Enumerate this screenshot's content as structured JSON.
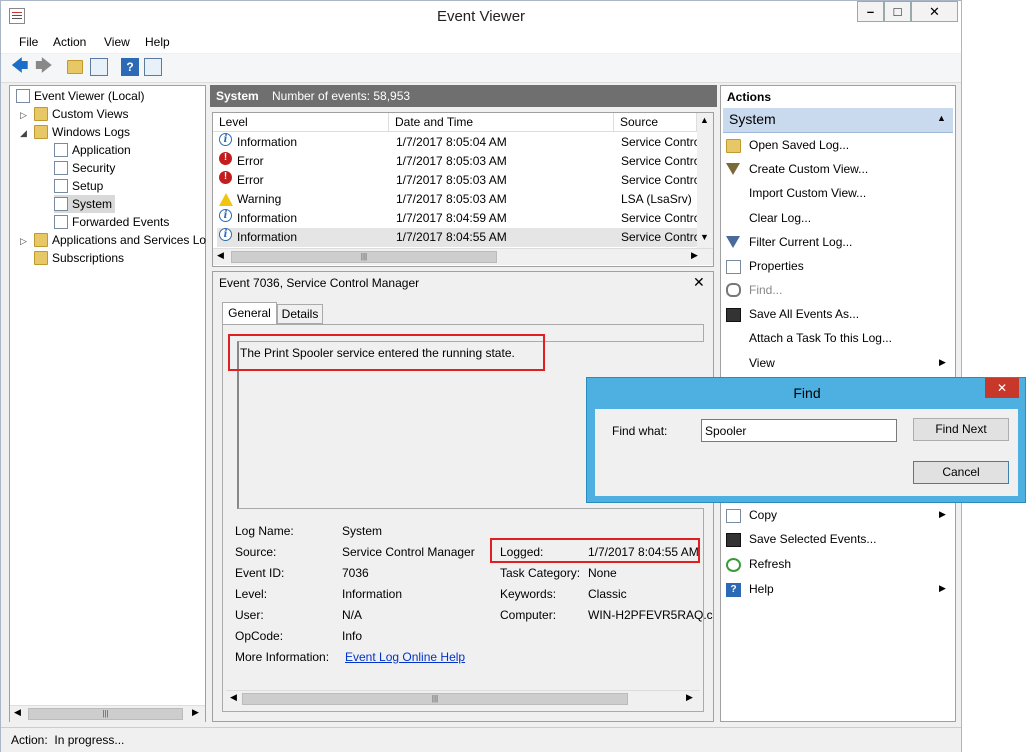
{
  "window": {
    "title": "Event Viewer"
  },
  "menu": [
    "File",
    "Action",
    "View",
    "Help"
  ],
  "tree": {
    "root": "Event Viewer (Local)",
    "custom_views": "Custom Views",
    "windows_logs": "Windows Logs",
    "application": "Application",
    "security": "Security",
    "setup": "Setup",
    "system": "System",
    "forwarded": "Forwarded Events",
    "apps_services": "Applications and Services Lo",
    "subscriptions": "Subscriptions"
  },
  "log_header": {
    "name": "System",
    "count": "Number of events: 58,953"
  },
  "columns": [
    "Level",
    "Date and Time",
    "Source"
  ],
  "events": [
    {
      "level": "Information",
      "icon": "info",
      "time": "1/7/2017 8:05:04 AM",
      "source": "Service Contro"
    },
    {
      "level": "Error",
      "icon": "error",
      "time": "1/7/2017 8:05:03 AM",
      "source": "Service Contro"
    },
    {
      "level": "Error",
      "icon": "error",
      "time": "1/7/2017 8:05:03 AM",
      "source": "Service Contro"
    },
    {
      "level": "Warning",
      "icon": "warning",
      "time": "1/7/2017 8:05:03 AM",
      "source": "LSA (LsaSrv)"
    },
    {
      "level": "Information",
      "icon": "info",
      "time": "1/7/2017 8:04:59 AM",
      "source": "Service Contro"
    },
    {
      "level": "Information",
      "icon": "info",
      "time": "1/7/2017 8:04:55 AM",
      "source": "Service Contro"
    }
  ],
  "detail": {
    "title": "Event 7036, Service Control Manager",
    "tabs": [
      "General",
      "Details"
    ],
    "message": "The Print Spooler service entered the running state.",
    "log_name_label": "Log Name:",
    "log_name": "System",
    "source_label": "Source:",
    "source": "Service Control Manager",
    "logged_label": "Logged:",
    "logged": "1/7/2017 8:04:55 AM",
    "event_id_label": "Event ID:",
    "event_id": "7036",
    "task_label": "Task Category:",
    "task": "None",
    "level_label": "Level:",
    "level": "Information",
    "keywords_label": "Keywords:",
    "keywords": "Classic",
    "user_label": "User:",
    "user": "N/A",
    "computer_label": "Computer:",
    "computer": "WIN-H2PFEVR5RAQ.c",
    "opcode_label": "OpCode:",
    "opcode": "Info",
    "more_label": "More Information:",
    "more_link": "Event Log Online Help"
  },
  "actions": {
    "header": "Actions",
    "section": "System",
    "items": [
      "Open Saved Log...",
      "Create Custom View...",
      "Import Custom View...",
      "Clear Log...",
      "Filter Current Log...",
      "Properties",
      "Find...",
      "Save All Events As...",
      "Attach a Task To this Log...",
      "View"
    ],
    "lower_items": [
      "Copy",
      "Save Selected Events...",
      "Refresh",
      "Help"
    ]
  },
  "find_dialog": {
    "title": "Find",
    "label": "Find what:",
    "value": "Spooler",
    "find_next": "Find Next",
    "cancel": "Cancel"
  },
  "status": "Action:  In progress..."
}
